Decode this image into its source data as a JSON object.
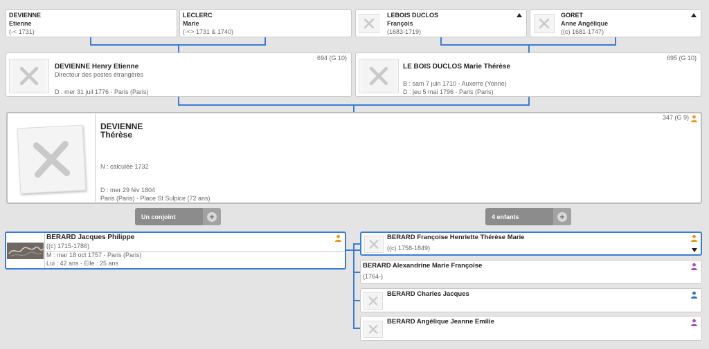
{
  "gp": [
    {
      "surname": "DEVIENNE",
      "first": "Etienne",
      "dates": "(-< 1731)"
    },
    {
      "surname": "LECLERC",
      "first": "Marie",
      "dates": "(-<> 1731 & 1740)"
    },
    {
      "surname": "LEBOIS DUCLOS",
      "first": "François",
      "dates": "(1683-1719)"
    },
    {
      "surname": "GORET",
      "first": "Anne Angélique",
      "dates": "((c) 1681-1747)"
    }
  ],
  "father": {
    "name": "DEVIENNE Henry Etienne",
    "occupation": "Directeur des postes étrangères",
    "death": "D : mer 31 juil 1776 - Paris (Paris)",
    "ref": "694 (G 10)"
  },
  "mother": {
    "name": "LE BOIS DUCLOS Marie Thérèse",
    "birth": "B : sam 7 juin 1710 - Auxerre (Yonne)",
    "death": "D : jeu 5 mai 1796 - Paris (Paris)",
    "ref": "695 (G 10)"
  },
  "main": {
    "surname": "DEVIENNE",
    "first": "Thérèse",
    "birth": "N : calculée 1732",
    "death": "D : mer 29 fév 1804",
    "death_place": "Paris (Paris) - Place St Sulpice (72 ans)",
    "ref": "347 (G 9)"
  },
  "buttons": {
    "spouses": "Un conjoint",
    "children": "4 enfants"
  },
  "spouse": {
    "name": "BERARD Jacques Philippe",
    "dates": "((c) 1715-1786)",
    "marriage": "M : mar 18 oct 1757 - Paris (Paris)",
    "ages": "Lui : 42 ans - Elle : 25 ans"
  },
  "children": [
    {
      "name": "BERARD Françoise Henriette Thérèse Marie",
      "dates": "((c) 1758-1849)",
      "sex": "female"
    },
    {
      "name": "BERARD Alexandrine Marie Françoise",
      "dates": "(1764-)",
      "sex": "female"
    },
    {
      "name": "BERARD Charles Jacques",
      "dates": "",
      "sex": "male"
    },
    {
      "name": "BERARD Angélique Jeanne Emilie",
      "dates": "",
      "sex": "female"
    }
  ],
  "colors": {
    "accent": "#3a7bd5",
    "female": "#a24bbd",
    "male": "#2a6fc0",
    "neutral": "#e39a1d"
  }
}
